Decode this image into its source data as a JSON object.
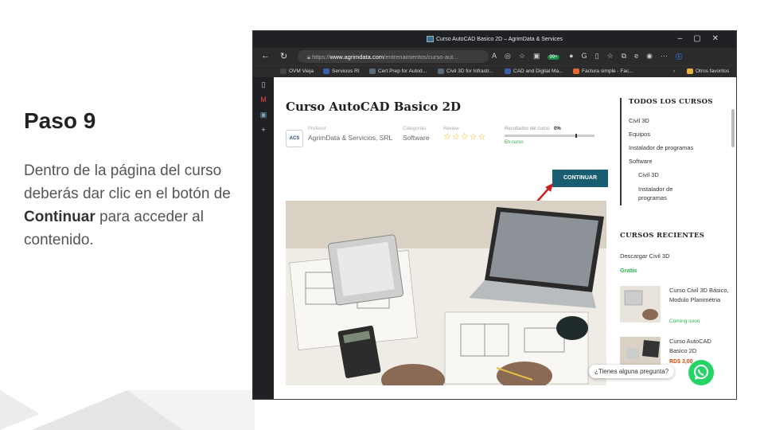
{
  "slide": {
    "title": "Paso 9",
    "body_pre": "Dentro de la página del curso deberás dar clic en el botón de ",
    "body_bold": "Continuar",
    "body_post": " para acceder al contenido."
  },
  "browser": {
    "window_title": "Curso AutoCAD Basico 2D – AgrimData & Services",
    "url_prefix": "https://",
    "url_domain": "www.agrimdata.com",
    "url_path": "/entrenamientos/curso-aut...",
    "badge_count": "99+",
    "bookmarks": [
      {
        "label": "OVM Vieja",
        "color": "#444444"
      },
      {
        "label": "Servicios RI",
        "color": "#3b5fa8"
      },
      {
        "label": "Cert Prep for Autod...",
        "color": "#5b6b7a"
      },
      {
        "label": "Civil 3D for Infrastr...",
        "color": "#5b6b7a"
      },
      {
        "label": "CAD and Digital Ma...",
        "color": "#3b5fa8"
      },
      {
        "label": "Factura simple - Fac...",
        "color": "#e8662f"
      }
    ],
    "other_favorites": "Otros favoritos"
  },
  "course": {
    "title": "Curso AutoCAD Basico 2D",
    "logo_text": "ACS",
    "teacher_label": "Profesor",
    "teacher_value": "AgrimData & Servicios, SRL",
    "category_label": "Categorías",
    "category_value": "Software",
    "review_label": "Review",
    "stars": "☆☆☆☆☆",
    "progress_label": "Resultados del curso",
    "progress_value": "0%",
    "progress_fraction": 0.0,
    "progress_status": "En curso",
    "continue_label": "CONTINUAR"
  },
  "right_sidebar": {
    "all_courses_heading": "TODOS LOS CURSOS",
    "categories": [
      "Civil 3D",
      "Equipos",
      "Instalador de programas",
      "Software"
    ],
    "subcategories": [
      "Civil 3D",
      "Instalador de programas"
    ],
    "recent_heading": "CURSOS RECIENTES",
    "recent_top_title": "Descargar Civil 3D",
    "recent_top_price": "Gratis",
    "recent": [
      {
        "title": "Curso Civil 3D Básico, Modulo Planimétria",
        "status": "Coming soon"
      },
      {
        "title": "Curso AutoCAD Basico 2D",
        "status": "RD$ 3,00"
      }
    ]
  },
  "whatsapp": {
    "bubble_text": "¿Tienes alguna pregunta?"
  },
  "colors": {
    "accent": "#195d73",
    "arrow": "#cc1f1f",
    "green": "#2db14b",
    "whatsapp": "#25d366"
  }
}
